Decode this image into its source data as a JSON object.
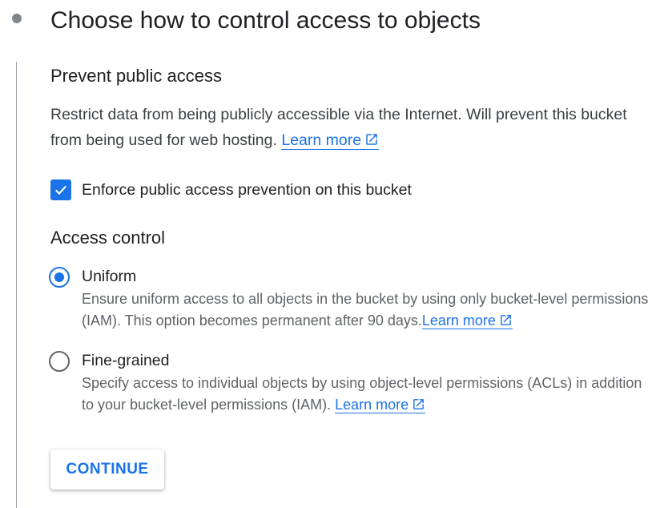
{
  "step": {
    "title": "Choose how to control access to objects"
  },
  "prevent_public_access": {
    "heading": "Prevent public access",
    "description": "Restrict data from being publicly accessible via the Internet. Will prevent this bucket from being used for web hosting.",
    "learn_more": "Learn more",
    "checkbox_label": "Enforce public access prevention on this bucket",
    "checkbox_checked": true
  },
  "access_control": {
    "heading": "Access control",
    "options": [
      {
        "label": "Uniform",
        "description": "Ensure uniform access to all objects in the bucket by using only bucket-level permissions (IAM). This option becomes permanent after 90 days.",
        "learn_more": "Learn more",
        "selected": true
      },
      {
        "label": "Fine-grained",
        "description": "Specify access to individual objects by using object-level permissions (ACLs) in addition to your bucket-level permissions (IAM).",
        "learn_more": "Learn more",
        "selected": false
      }
    ]
  },
  "actions": {
    "continue_label": "CONTINUE"
  },
  "colors": {
    "accent": "#1a73e8",
    "text_primary": "#202124",
    "text_secondary": "#5f6368",
    "step_indicator": "#80868b"
  },
  "icons": {
    "external_link": "open-in-new-icon",
    "checkbox": "check-icon"
  }
}
